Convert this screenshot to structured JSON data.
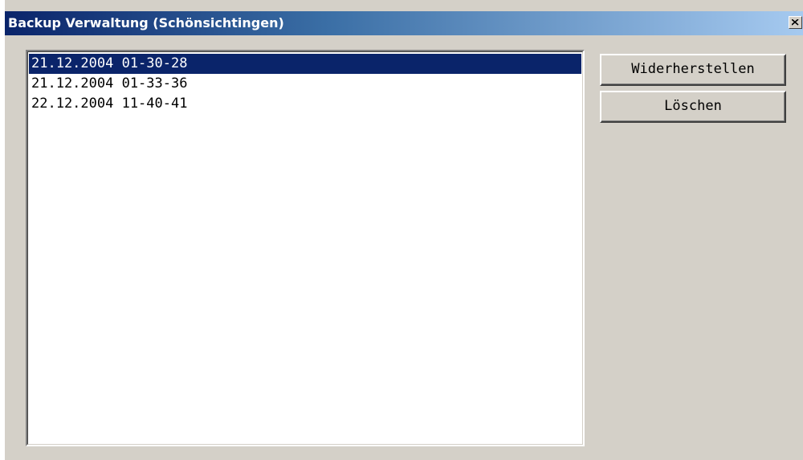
{
  "window": {
    "title": "Backup Verwaltung (Schönsichtingen)",
    "close_icon": "close-icon"
  },
  "backups": {
    "items": [
      {
        "label": "21.12.2004 01-30-28",
        "selected": true
      },
      {
        "label": "21.12.2004 01-33-36",
        "selected": false
      },
      {
        "label": "22.12.2004 11-40-41",
        "selected": false
      }
    ]
  },
  "actions": {
    "restore_label": "Widerherstellen",
    "delete_label": "Löschen"
  },
  "colors": {
    "title_gradient_start": "#0a246a",
    "title_gradient_end": "#a6caf0",
    "selection": "#0a246a",
    "face": "#d4d0c8"
  }
}
